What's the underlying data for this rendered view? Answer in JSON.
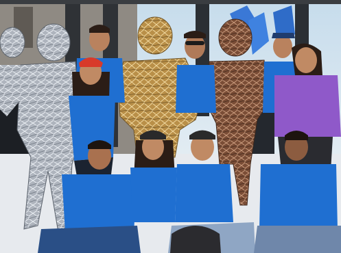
{
  "photo": {
    "subject": "group-photo",
    "colors": {
      "sky": "#cfe1ee",
      "ground": "#eef0f2",
      "polo_blue": "#1f6fd1",
      "polo_blue_dark": "#154f9c",
      "hoodie_purple": "#8f59c9",
      "mirror_silver": "#b9bec6",
      "mirror_gold": "#c9a25a",
      "mirror_bronze": "#8a5a3e",
      "skin": "#b9825e",
      "hair": "#2b1d16"
    }
  }
}
